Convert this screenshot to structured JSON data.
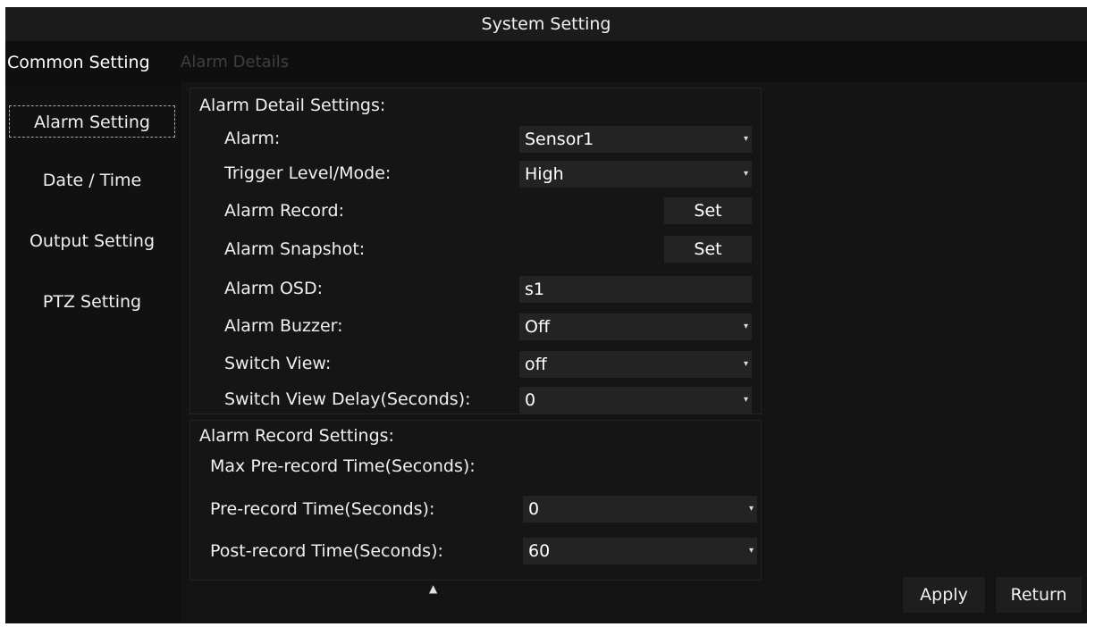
{
  "window": {
    "title": "System Setting"
  },
  "main_tabs": [
    {
      "label": "Common Setting",
      "active": true
    },
    {
      "label": "Alarm Details",
      "active": false
    }
  ],
  "sidebar": {
    "items": [
      {
        "label": "Alarm Setting",
        "active": true
      },
      {
        "label": "Date / Time",
        "active": false
      },
      {
        "label": "Output Setting",
        "active": false
      },
      {
        "label": "PTZ Setting",
        "active": false
      }
    ]
  },
  "alarm_detail": {
    "title": "Alarm Detail Settings:",
    "alarm": {
      "label": "Alarm:",
      "value": "Sensor1"
    },
    "trigger": {
      "label": "Trigger Level/Mode:",
      "value": "High"
    },
    "record": {
      "label": "Alarm Record:",
      "button": "Set"
    },
    "snapshot": {
      "label": "Alarm Snapshot:",
      "button": "Set"
    },
    "osd": {
      "label": "Alarm OSD:",
      "value": "s1"
    },
    "buzzer": {
      "label": "Alarm Buzzer:",
      "value": "Off"
    },
    "switch_view": {
      "label": "Switch View:",
      "value": "off"
    },
    "switch_delay": {
      "label": "Switch View Delay(Seconds):",
      "value": "0"
    }
  },
  "alarm_record": {
    "title": "Alarm Record Settings:",
    "max_pre": {
      "label": "Max Pre-record Time(Seconds):"
    },
    "pre": {
      "label": "Pre-record Time(Seconds):",
      "value": "0"
    },
    "post": {
      "label": "Post-record Time(Seconds):",
      "value": "60"
    }
  },
  "buttons": {
    "apply": "Apply",
    "return": "Return"
  },
  "icons": {
    "dropdown": "dropdown-arrow-icon",
    "cursor": "mouse-pointer-icon"
  },
  "colors": {
    "background": "#0f0f0f",
    "field": "#232323",
    "text": "#f2f2f2"
  }
}
